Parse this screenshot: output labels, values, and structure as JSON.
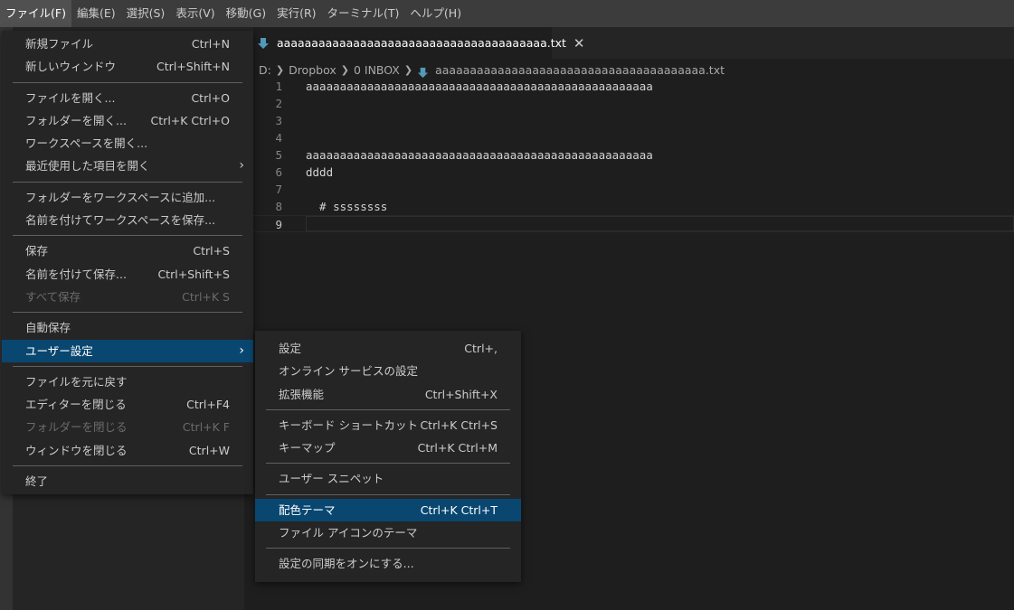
{
  "menubar": {
    "items": [
      "ファイル(F)",
      "編集(E)",
      "選択(S)",
      "表示(V)",
      "移動(G)",
      "実行(R)",
      "ターミナル(T)",
      "ヘルプ(H)"
    ]
  },
  "tab": {
    "filename": "aaaaaaaaaaaaaaaaaaaaaaaaaaaaaaaaaaaaaaa.txt",
    "close_glyph": "✕",
    "icon": "file-download-icon"
  },
  "breadcrumb": {
    "parts": [
      "D:",
      "Dropbox",
      "0 INBOX"
    ],
    "file": "aaaaaaaaaaaaaaaaaaaaaaaaaaaaaaaaaaaaaaa.txt"
  },
  "editor": {
    "lines": [
      {
        "num": "1",
        "text": "aaaaaaaaaaaaaaaaaaaaaaaaaaaaaaaaaaaaaaaaaaaaaaaaaaa"
      },
      {
        "num": "2",
        "text": ""
      },
      {
        "num": "3",
        "text": ""
      },
      {
        "num": "4",
        "text": ""
      },
      {
        "num": "5",
        "text": "aaaaaaaaaaaaaaaaaaaaaaaaaaaaaaaaaaaaaaaaaaaaaaaaaaa"
      },
      {
        "num": "6",
        "text": "dddd"
      },
      {
        "num": "7",
        "text": ""
      },
      {
        "num": "8",
        "text": "  # ssssssss"
      },
      {
        "num": "9",
        "text": ""
      }
    ]
  },
  "file_menu": {
    "new_file": {
      "label": "新規ファイル",
      "kb": "Ctrl+N"
    },
    "new_window": {
      "label": "新しいウィンドウ",
      "kb": "Ctrl+Shift+N"
    },
    "open_file": {
      "label": "ファイルを開く...",
      "kb": "Ctrl+O"
    },
    "open_folder": {
      "label": "フォルダーを開く...",
      "kb": "Ctrl+K Ctrl+O"
    },
    "open_workspace": {
      "label": "ワークスペースを開く..."
    },
    "open_recent": {
      "label": "最近使用した項目を開く",
      "arrow": "›"
    },
    "add_folder": {
      "label": "フォルダーをワークスペースに追加..."
    },
    "save_workspace_as": {
      "label": "名前を付けてワークスペースを保存..."
    },
    "save": {
      "label": "保存",
      "kb": "Ctrl+S"
    },
    "save_as": {
      "label": "名前を付けて保存...",
      "kb": "Ctrl+Shift+S"
    },
    "save_all": {
      "label": "すべて保存",
      "kb": "Ctrl+K S"
    },
    "auto_save": {
      "label": "自動保存"
    },
    "preferences": {
      "label": "ユーザー設定",
      "arrow": "›"
    },
    "revert_file": {
      "label": "ファイルを元に戻す"
    },
    "close_editor": {
      "label": "エディターを閉じる",
      "kb": "Ctrl+F4"
    },
    "close_folder": {
      "label": "フォルダーを閉じる",
      "kb": "Ctrl+K F"
    },
    "close_window": {
      "label": "ウィンドウを閉じる",
      "kb": "Ctrl+W"
    },
    "exit": {
      "label": "終了"
    }
  },
  "prefs_menu": {
    "settings": {
      "label": "設定",
      "kb": "Ctrl+,"
    },
    "online_services": {
      "label": "オンライン サービスの設定"
    },
    "extensions": {
      "label": "拡張機能",
      "kb": "Ctrl+Shift+X"
    },
    "keyboard_shortcuts": {
      "label": "キーボード ショートカット",
      "kb": "Ctrl+K Ctrl+S"
    },
    "keymaps": {
      "label": "キーマップ",
      "kb": "Ctrl+K Ctrl+M"
    },
    "user_snippets": {
      "label": "ユーザー スニペット"
    },
    "color_theme": {
      "label": "配色テーマ",
      "kb": "Ctrl+K Ctrl+T"
    },
    "file_icon_theme": {
      "label": "ファイル アイコンのテーマ"
    },
    "turn_on_sync": {
      "label": "設定の同期をオンにする..."
    }
  },
  "colors": {
    "highlight": "#094771",
    "file_icon": "#519aba"
  }
}
